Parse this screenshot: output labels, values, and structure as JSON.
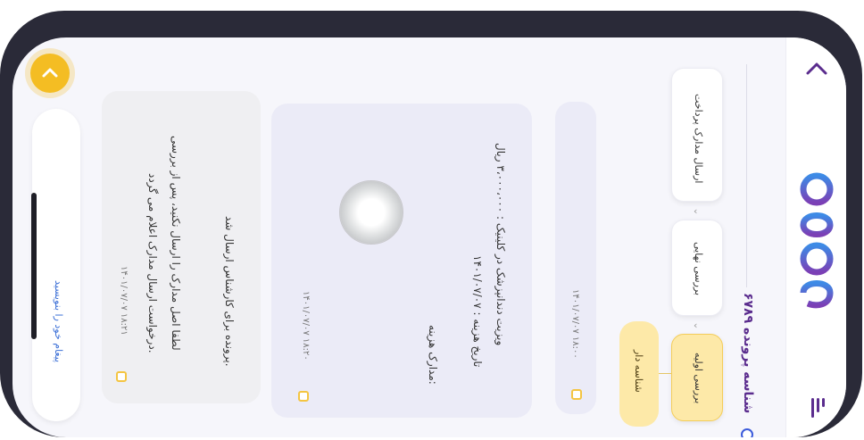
{
  "header": {
    "case_title": "شناسه پرونده ۶۷۸۹",
    "brand": "logo"
  },
  "steps": [
    {
      "label": "ارسال مدارک پرداخت"
    },
    {
      "label": "بررسی نهایی"
    },
    {
      "label": "بررسی اولیه"
    }
  ],
  "action_button": {
    "label": "شناسه دار"
  },
  "cards": {
    "partial": {
      "meta": "۱۴۰۱/۰۷/۰۷   ۱۸:۰۰"
    },
    "invoice": {
      "line1": "ویزیت دندانپزشک در کلینیک : ۳،۰۰۰،۰۰۰ ریال",
      "line2": "تاریخ هزینه : ۱۴۰۱/۰۷/۰۷",
      "line3": "مدارک هزینه:",
      "meta": "۱۴۰۱/۰۷/۰۷   ۱۸:۲۰"
    },
    "message": {
      "line1": "پرونده برای کارشناس ارسال شد.",
      "line2": "لطفا اصل مدارک را ارسال نکنید، پس از بررسی",
      "line3": "درخواست ارسال مدارک اعلام می گردد.",
      "meta": "۱۴۰۱/۰۷/۰۷   ۱۸:۲۱"
    }
  },
  "input": {
    "placeholder": "پیغام خود را بنویسید"
  },
  "icons": [
    "back-chevron-icon",
    "menu-icon",
    "scroll-up-icon",
    "date-icon",
    "stamp-image"
  ]
}
